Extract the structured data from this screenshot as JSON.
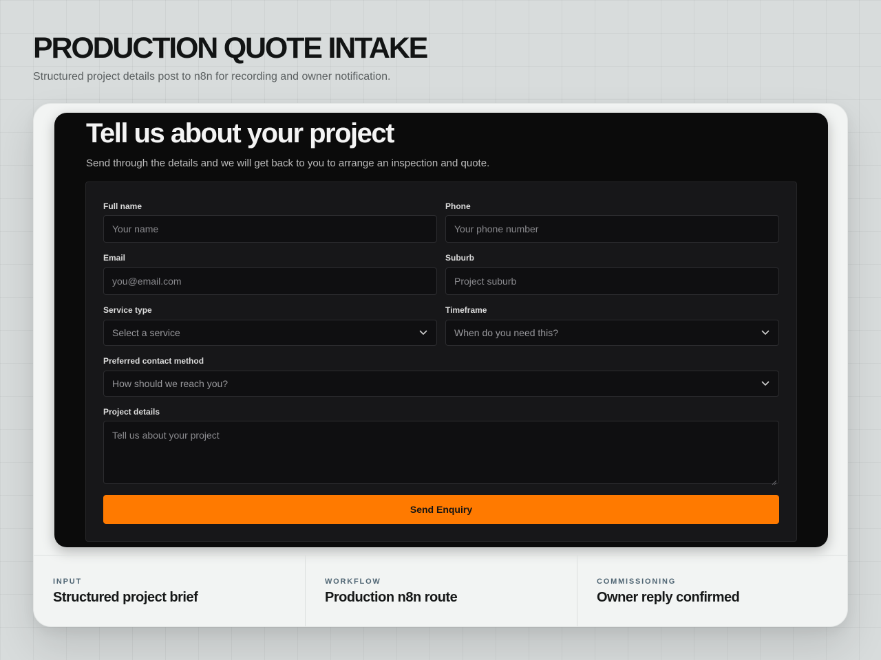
{
  "page": {
    "title": "PRODUCTION QUOTE INTAKE",
    "subtitle": "Structured project details post to n8n for recording and owner notification."
  },
  "form": {
    "heading": "Tell us about your project",
    "intro": "Send through the details and we will get back to you to arrange an inspection and quote.",
    "full_name": {
      "label": "Full name",
      "placeholder": "Your name"
    },
    "phone": {
      "label": "Phone",
      "placeholder": "Your phone number"
    },
    "email": {
      "label": "Email",
      "placeholder": "you@email.com"
    },
    "suburb": {
      "label": "Suburb",
      "placeholder": "Project suburb"
    },
    "service_type": {
      "label": "Service type",
      "selected": "Select a service"
    },
    "timeframe": {
      "label": "Timeframe",
      "selected": "When do you need this?"
    },
    "contact_method": {
      "label": "Preferred contact method",
      "selected": "How should we reach you?"
    },
    "project_details": {
      "label": "Project details",
      "placeholder": "Tell us about your project"
    },
    "submit_label": "Send Enquiry"
  },
  "features": [
    {
      "kicker": "INPUT",
      "title": "Structured project brief"
    },
    {
      "kicker": "WORKFLOW",
      "title": "Production n8n route"
    },
    {
      "kicker": "COMMISSIONING",
      "title": "Owner reply confirmed"
    }
  ],
  "colors": {
    "accent": "#ff7a00",
    "panel": "#0b0b0b",
    "form_surface": "#171719",
    "page_background": "#d8dcdc"
  },
  "icons": {
    "select_indicator": "chevron-down-icon",
    "textarea_resize": "resize-grip-icon"
  }
}
